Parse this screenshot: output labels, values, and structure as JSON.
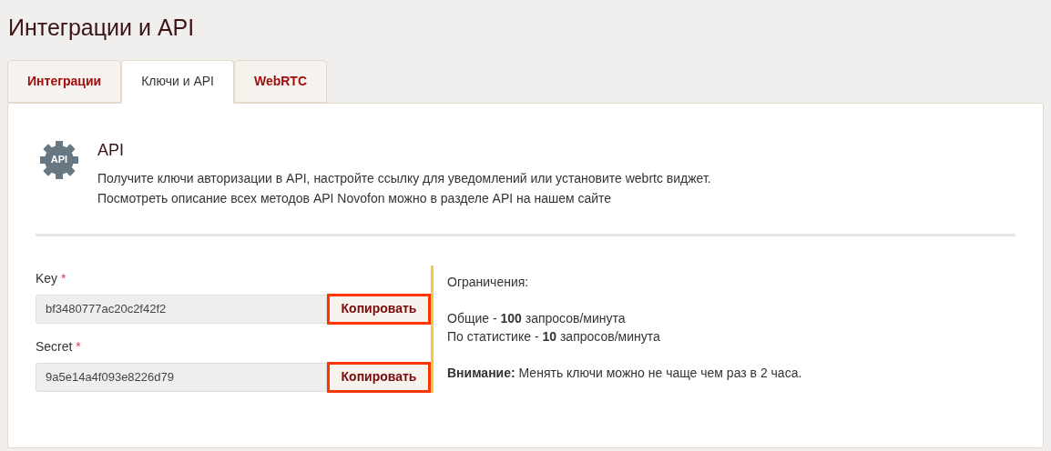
{
  "page_title": "Интеграции и API",
  "tabs": [
    {
      "label": "Интеграции",
      "selected": false
    },
    {
      "label": "Ключи и API",
      "selected": true
    },
    {
      "label": "WebRTC",
      "selected": false
    }
  ],
  "section": {
    "icon_label": "API",
    "title": "API",
    "lines": [
      "Получите ключи авторизации в API, настройте ссылку для уведомлений или установите webrtc виджет.",
      "Посмотреть описание всех методов API Novofon можно в разделе API на нашем сайте"
    ]
  },
  "fields": [
    {
      "label": "Key",
      "required_mark": "*",
      "value": "bf3480777ac20c2f42f2",
      "button": "Копировать",
      "highlighted": true
    },
    {
      "label": "Secret",
      "required_mark": "*",
      "value": "9a5e14a4f093e8226d79",
      "button": "Копировать",
      "highlighted": true
    }
  ],
  "limits": {
    "heading": "Ограничения:",
    "lines": [
      "Общие - **100** запросов/минута",
      "По статистике - **10** запросов/минута"
    ],
    "note": "**Внимание:** Менять ключи можно не чаще чем раз в 2 часа."
  }
}
